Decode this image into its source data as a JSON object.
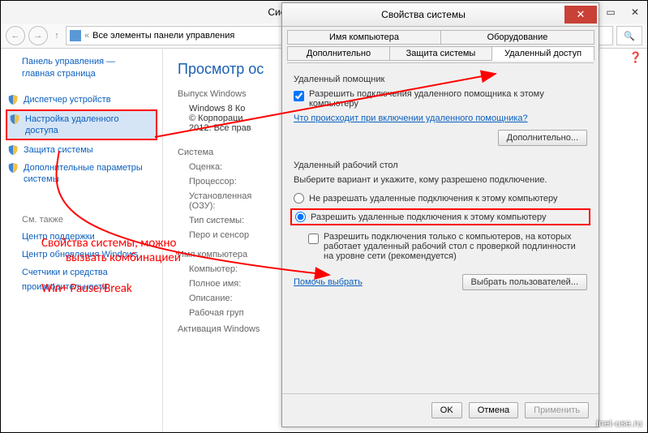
{
  "window": {
    "title": "Система",
    "breadcrumb": "Все элементы панели управления",
    "buttons": {
      "min": "—",
      "max": "▭",
      "close": "✕"
    }
  },
  "sidebar": {
    "home_line1": "Панель управления —",
    "home_line2": "главная страница",
    "items": [
      {
        "label": "Диспетчер устройств"
      },
      {
        "label": "Настройка удаленного доступа"
      },
      {
        "label": "Защита системы"
      },
      {
        "label": "Дополнительные параметры системы"
      }
    ],
    "also": "См. также",
    "also_links": [
      "Центр поддержки",
      "Центр обновления Windows",
      "Счетчики и средства производительности"
    ]
  },
  "main": {
    "heading": "Просмотр ос",
    "ed_label": "Выпуск Windows",
    "ed_value": "Windows 8 Ко",
    "copyright1": "© Корпораци",
    "copyright2": "2012. Все прав",
    "system_label": "Система",
    "rows": {
      "rating": "Оценка:",
      "cpu": "Процессор:",
      "ram_label": "Установленная",
      "ram_sub": "(ОЗУ):",
      "type": "Тип системы:",
      "pen": "Перо и сенсор",
      "name_section": "Имя компьютера",
      "computer": "Компьютер:",
      "fullname": "Полное имя:",
      "desc": "Описание:",
      "workgroup": "Рабочая груп",
      "activation": "Активация Windows"
    }
  },
  "dialog": {
    "title": "Свойства системы",
    "close": "✕",
    "tabs_top": [
      "Имя компьютера",
      "Оборудование"
    ],
    "tabs_bottom": [
      "Дополнительно",
      "Защита системы",
      "Удаленный доступ"
    ],
    "assist_title": "Удаленный помощник",
    "assist_cb": "Разрешить подключения удаленного помощника к этому компьютеру",
    "assist_link": "Что происходит при включении удаленного помощника?",
    "assist_button": "Дополнительно...",
    "rdp_title": "Удаленный рабочий стол",
    "rdp_text": "Выберите вариант и укажите, кому разрешено подключение.",
    "rdp_opt1": "Не разрешать удаленные подключения к этому компьютеру",
    "rdp_opt2": "Разрешить удаленные подключения к этому компьютеру",
    "rdp_cb": "Разрешить подключения только с компьютеров, на которых работает удаленный рабочий стол с проверкой подлинности на уровне сети (рекомендуется)",
    "help_link": "Помочь выбрать",
    "users_button": "Выбрать пользователей...",
    "footer": {
      "ok": "OK",
      "cancel": "Отмена",
      "apply": "Применить"
    }
  },
  "annotations": {
    "line1": "Свойства системы, можно",
    "line2": "вызвать комбинацией",
    "line3": "Win+ Pause/Break"
  },
  "colors": {
    "accent": "#0a5fbf",
    "red": "#e00000",
    "close": "#c84036"
  },
  "watermark": "inet-use.ru"
}
